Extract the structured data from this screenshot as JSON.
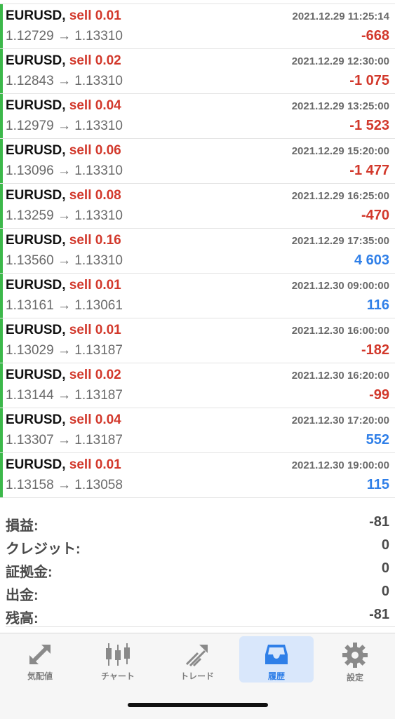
{
  "trades": [
    {
      "symbol": "EURUSD",
      "side": "sell 0.01",
      "time": "2021.12.29 11:25:14",
      "open": "1.12729",
      "close": "1.13310",
      "profit": "-668",
      "sign": "neg"
    },
    {
      "symbol": "EURUSD",
      "side": "sell 0.02",
      "time": "2021.12.29 12:30:00",
      "open": "1.12843",
      "close": "1.13310",
      "profit": "-1 075",
      "sign": "neg"
    },
    {
      "symbol": "EURUSD",
      "side": "sell 0.04",
      "time": "2021.12.29 13:25:00",
      "open": "1.12979",
      "close": "1.13310",
      "profit": "-1 523",
      "sign": "neg"
    },
    {
      "symbol": "EURUSD",
      "side": "sell 0.06",
      "time": "2021.12.29 15:20:00",
      "open": "1.13096",
      "close": "1.13310",
      "profit": "-1 477",
      "sign": "neg"
    },
    {
      "symbol": "EURUSD",
      "side": "sell 0.08",
      "time": "2021.12.29 16:25:00",
      "open": "1.13259",
      "close": "1.13310",
      "profit": "-470",
      "sign": "neg"
    },
    {
      "symbol": "EURUSD",
      "side": "sell 0.16",
      "time": "2021.12.29 17:35:00",
      "open": "1.13560",
      "close": "1.13310",
      "profit": "4 603",
      "sign": "pos"
    },
    {
      "symbol": "EURUSD",
      "side": "sell 0.01",
      "time": "2021.12.30 09:00:00",
      "open": "1.13161",
      "close": "1.13061",
      "profit": "116",
      "sign": "pos"
    },
    {
      "symbol": "EURUSD",
      "side": "sell 0.01",
      "time": "2021.12.30 16:00:00",
      "open": "1.13029",
      "close": "1.13187",
      "profit": "-182",
      "sign": "neg"
    },
    {
      "symbol": "EURUSD",
      "side": "sell 0.02",
      "time": "2021.12.30 16:20:00",
      "open": "1.13144",
      "close": "1.13187",
      "profit": "-99",
      "sign": "neg"
    },
    {
      "symbol": "EURUSD",
      "side": "sell 0.04",
      "time": "2021.12.30 17:20:00",
      "open": "1.13307",
      "close": "1.13187",
      "profit": "552",
      "sign": "pos"
    },
    {
      "symbol": "EURUSD",
      "side": "sell 0.01",
      "time": "2021.12.30 19:00:00",
      "open": "1.13158",
      "close": "1.13058",
      "profit": "115",
      "sign": "pos"
    }
  ],
  "arrow": "→",
  "summary": [
    {
      "label": "損益:",
      "value": "-81"
    },
    {
      "label": "クレジット:",
      "value": "0"
    },
    {
      "label": "証拠金:",
      "value": "0"
    },
    {
      "label": "出金:",
      "value": "0"
    },
    {
      "label": "残高:",
      "value": "-81"
    }
  ],
  "tabs": [
    {
      "label": "気配値",
      "icon": "quotes-arrows-icon",
      "active": false
    },
    {
      "label": "チャート",
      "icon": "candlestick-chart-icon",
      "active": false
    },
    {
      "label": "トレード",
      "icon": "trade-trend-icon",
      "active": false
    },
    {
      "label": "履歴",
      "icon": "history-inbox-icon",
      "active": true
    },
    {
      "label": "設定",
      "icon": "gear-icon",
      "active": false
    }
  ],
  "colors": {
    "loss": "#d2382b",
    "profit": "#2f7fe8",
    "accent_bar": "#3cb84a",
    "active_tab_bg": "#d9e7fb",
    "tab_icon": "#8a8a8a"
  }
}
